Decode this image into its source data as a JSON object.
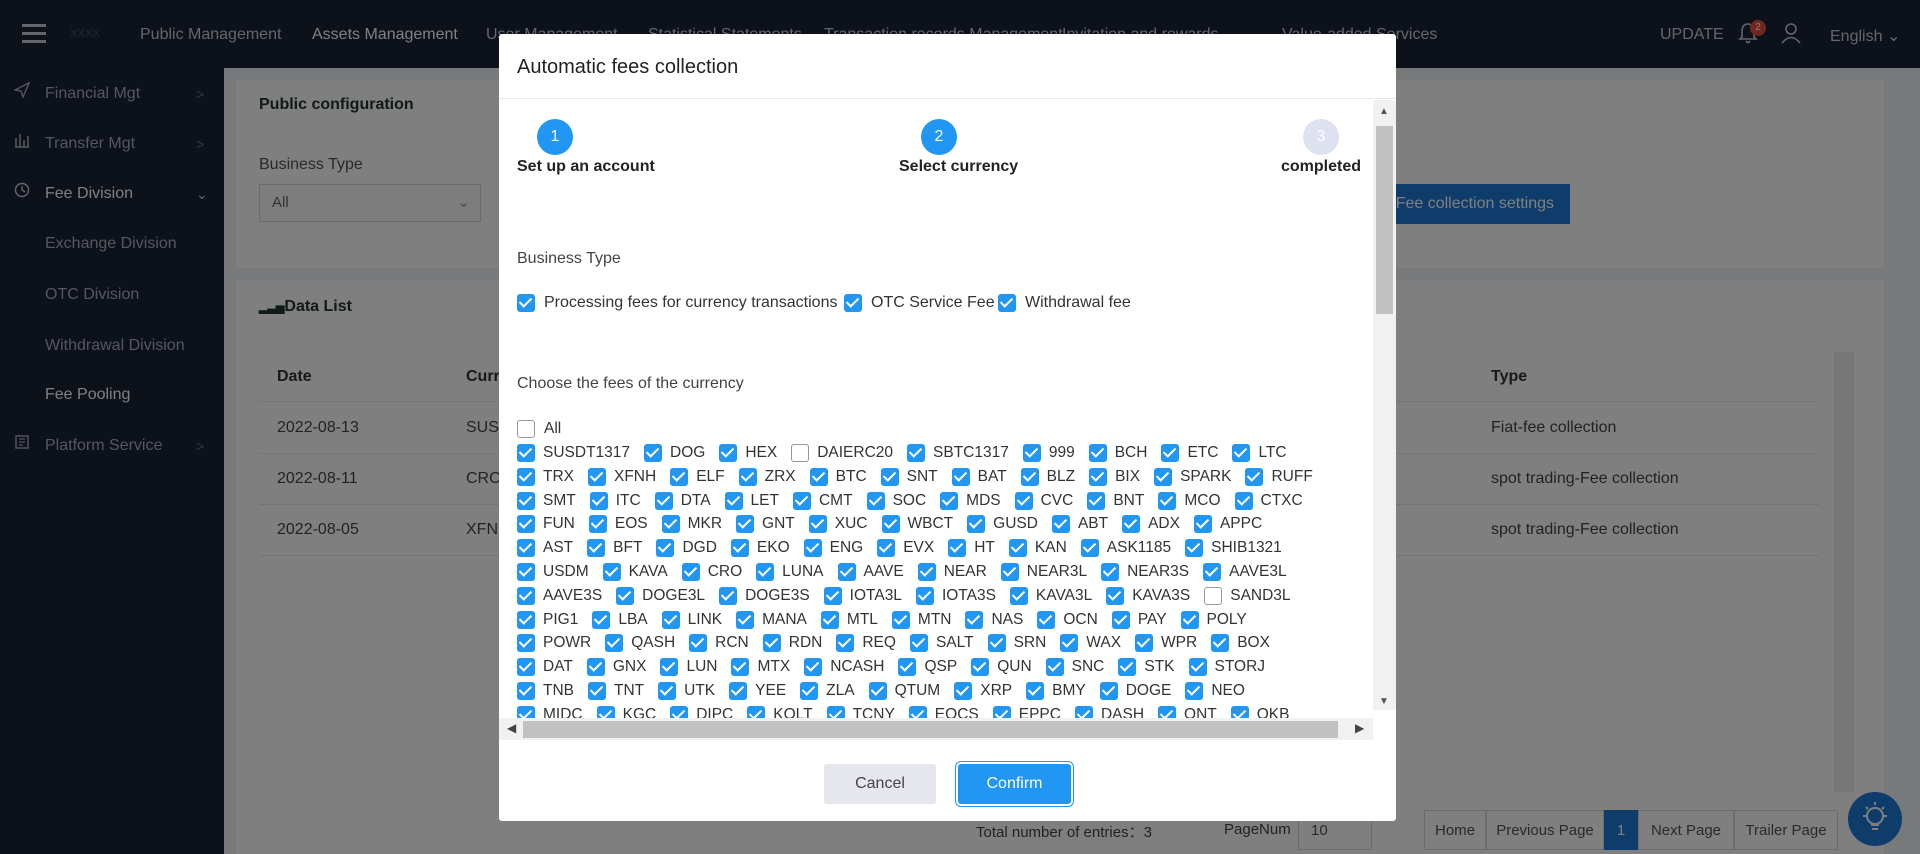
{
  "topbar": {
    "logo": "xxxx",
    "nav": [
      "Public Management",
      "Assets Management",
      "User Management",
      "Statistical Statements",
      "Transaction records Management",
      "Invitation and rewards",
      "Value-added Services"
    ],
    "update": "UPDATE",
    "notifications": "2",
    "language": "English"
  },
  "sidebar": {
    "items": [
      {
        "label": "Financial Mgt",
        "icon": "send-icon"
      },
      {
        "label": "Transfer Mgt",
        "icon": "bar-chart-icon"
      },
      {
        "label": "Fee Division",
        "icon": "history-icon"
      },
      {
        "label": "Exchange Division"
      },
      {
        "label": "OTC Division"
      },
      {
        "label": "Withdrawal Division"
      },
      {
        "label": "Fee Pooling"
      },
      {
        "label": "Platform Service",
        "icon": "book-icon"
      }
    ]
  },
  "config": {
    "title": "Public configuration",
    "business_type_label": "Business Type",
    "business_type_value": "All",
    "settings_button": "Fee collection settings"
  },
  "data_list": {
    "title": "Data List",
    "columns": [
      "Date",
      "Currency",
      "Type"
    ],
    "rows": [
      {
        "date": "2022-08-13",
        "currency": "SUSDT",
        "type": "Fiat-fee collection"
      },
      {
        "date": "2022-08-11",
        "currency": "CRO",
        "type": "spot trading-Fee collection"
      },
      {
        "date": "2022-08-05",
        "currency": "XFNH",
        "type": "spot trading-Fee collection"
      }
    ],
    "total_label": "Total number of entries：3",
    "pagenum_label": "PageNum",
    "pagenum_value": "10",
    "pagination": [
      "Home",
      "Previous Page",
      "1",
      "Next Page",
      "Trailer Page"
    ]
  },
  "modal": {
    "title": "Automatic fees collection",
    "steps": [
      {
        "num": "1",
        "label": "Set up an account"
      },
      {
        "num": "2",
        "label": "Select currency"
      },
      {
        "num": "3",
        "label": "completed"
      }
    ],
    "business_type_label": "Business Type",
    "business_types": [
      "Processing fees for currency transactions",
      "OTC Service Fee",
      "Withdrawal fee"
    ],
    "currency_label": "Choose the fees of the currency",
    "all_label": "All",
    "currency_rows": [
      [
        "SUSDT1317",
        "DOG",
        "HEX",
        "DAIERC20",
        "SBTC1317",
        "999",
        "BCH",
        "ETC",
        "LTC"
      ],
      [
        "TRX",
        "XFNH",
        "ELF",
        "ZRX",
        "BTC",
        "SNT",
        "BAT",
        "BLZ",
        "BIX",
        "SPARK",
        "RUFF"
      ],
      [
        "SMT",
        "ITC",
        "DTA",
        "LET",
        "CMT",
        "SOC",
        "MDS",
        "CVC",
        "BNT",
        "MCO",
        "CTXC"
      ],
      [
        "FUN",
        "EOS",
        "MKR",
        "GNT",
        "XUC",
        "WBCT",
        "GUSD",
        "ABT",
        "ADX",
        "APPC"
      ],
      [
        "AST",
        "BFT",
        "DGD",
        "EKO",
        "ENG",
        "EVX",
        "HT",
        "KAN",
        "ASK1185",
        "SHIB1321"
      ],
      [
        "USDM",
        "KAVA",
        "CRO",
        "LUNA",
        "AAVE",
        "NEAR",
        "NEAR3L",
        "NEAR3S",
        "AAVE3L"
      ],
      [
        "AAVE3S",
        "DOGE3L",
        "DOGE3S",
        "IOTA3L",
        "IOTA3S",
        "KAVA3L",
        "KAVA3S",
        "SAND3L"
      ],
      [
        "PIG1",
        "LBA",
        "LINK",
        "MANA",
        "MTL",
        "MTN",
        "NAS",
        "OCN",
        "PAY",
        "POLY"
      ],
      [
        "POWR",
        "QASH",
        "RCN",
        "RDN",
        "REQ",
        "SALT",
        "SRN",
        "WAX",
        "WPR",
        "BOX"
      ],
      [
        "DAT",
        "GNX",
        "LUN",
        "MTX",
        "NCASH",
        "QSP",
        "QUN",
        "SNC",
        "STK",
        "STORJ"
      ],
      [
        "TNB",
        "TNT",
        "UTK",
        "YEE",
        "ZLA",
        "QTUM",
        "XRP",
        "BMY",
        "DOGE",
        "NEO"
      ],
      [
        "MIDC",
        "KGC",
        "DIPC",
        "KOLT",
        "TCNY",
        "EOCS",
        "EPPC",
        "DASH",
        "ONT",
        "OKB"
      ]
    ],
    "unchecked": [
      "DAIERC20",
      "SAND3L"
    ],
    "cancel": "Cancel",
    "confirm": "Confirm"
  }
}
